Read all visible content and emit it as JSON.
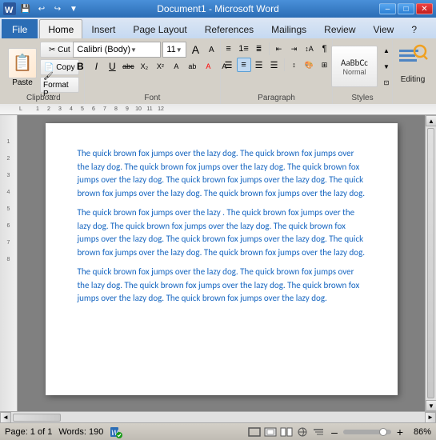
{
  "titlebar": {
    "title": "Document1 - Microsoft Word",
    "min_label": "–",
    "max_label": "□",
    "close_label": "✕",
    "qa_icons": [
      "💾",
      "↩",
      "↪",
      "⬇"
    ]
  },
  "tabs": [
    {
      "label": "File",
      "type": "file"
    },
    {
      "label": "Home",
      "active": true
    },
    {
      "label": "Insert"
    },
    {
      "label": "Page Layout"
    },
    {
      "label": "References"
    },
    {
      "label": "Mailings"
    },
    {
      "label": "Review"
    },
    {
      "label": "View"
    },
    {
      "label": "?"
    }
  ],
  "ribbon": {
    "paste_label": "Paste",
    "clipboard_label": "Clipboard",
    "font_name": "Calibri (Body)",
    "font_size": "11",
    "font_label": "Font",
    "paragraph_label": "Paragraph",
    "styles_label": "Styles",
    "editing_label": "Editing",
    "bold": "B",
    "italic": "I",
    "underline": "U",
    "strikethrough": "abc",
    "subscript": "X₂",
    "superscript": "X²"
  },
  "document": {
    "paragraphs": [
      "The quick brown fox jumps over the lazy dog. The quick brown fox jumps over the lazy dog. The quick brown fox jumps over the lazy dog. The quick brown fox jumps over the lazy dog. The quick brown fox jumps over the lazy dog. The quick brown fox jumps over the lazy dog. The quick brown fox jumps over the lazy dog.",
      "The quick brown fox jumps over the lazy . The quick brown fox jumps over the lazy dog. The quick brown fox jumps over the lazy dog. The quick brown fox jumps over the lazy dog. The quick brown fox jumps over the lazy dog. The quick brown fox jumps over the lazy dog. The quick brown fox jumps over the lazy dog.",
      "The quick brown fox jumps over the lazy dog. The quick brown fox jumps over the lazy dog. The quick brown fox jumps over the lazy dog. The quick brown fox jumps over the lazy dog. The quick brown fox jumps over the lazy dog."
    ]
  },
  "statusbar": {
    "page_info": "Page: 1 of 1",
    "words_info": "Words: 190",
    "zoom_level": "86%",
    "zoom_minus": "–",
    "zoom_plus": "+"
  }
}
